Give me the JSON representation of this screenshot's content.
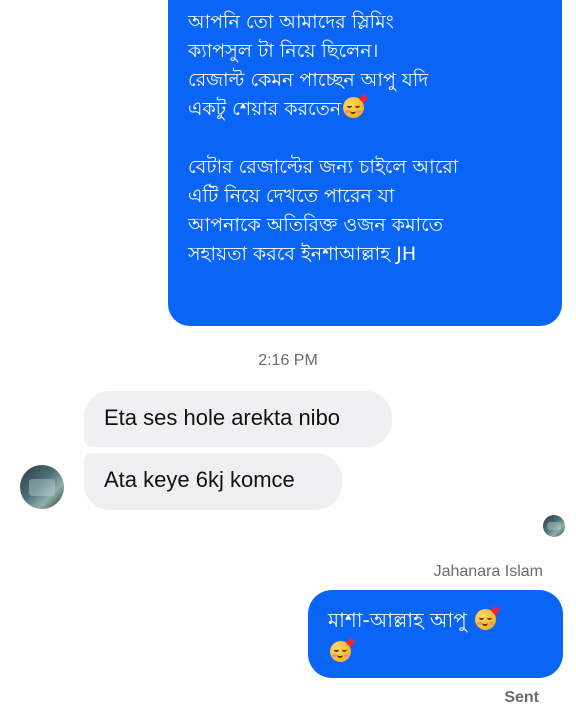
{
  "conversation": {
    "outgoing_long": {
      "paragraph1_lines": [
        "আপনি তো আমাদের স্লিমিং",
        "ক্যাপসুল টা নিয়ে ছিলেন।",
        "রেজাল্ট কেমন পাচ্ছেন আপু যদি",
        "একটু শেয়ার করতেন"
      ],
      "paragraph1_emoji": "smiling-face-with-hearts",
      "paragraph2_lines": [
        "বেটার রেজাল্টের জন্য চাইলে আরো",
        "এটি নিয়ে দেখতে পারেন যা",
        "আপনাকে অতিরিক্ত ওজন কমাতে",
        "সহায়তা করবে ইনশাআল্লাহ  JH"
      ]
    },
    "timestamp": "2:16 PM",
    "incoming": [
      {
        "text": "Eta ses hole arekta nibo"
      },
      {
        "text": "Ata keye 6kj komce"
      }
    ],
    "sender_name": "Jahanara Islam",
    "outgoing_short": {
      "text": "মাশা-আল্লাহ আপু",
      "emoji": "smiling-face-with-hearts"
    },
    "status": "Sent"
  },
  "colors": {
    "outgoing_bubble": "#0a65f6",
    "incoming_bubble": "#f0f0f3",
    "meta_text": "#6b6b70"
  }
}
